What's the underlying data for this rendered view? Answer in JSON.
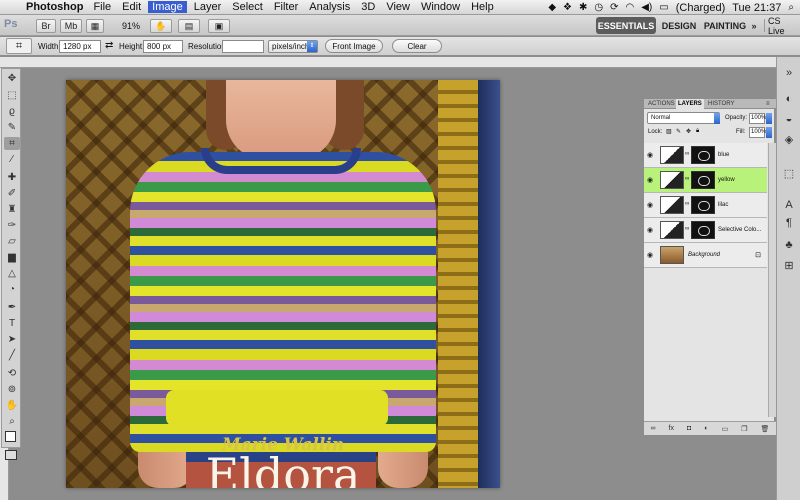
{
  "menubar": {
    "app_name": "Photoshop",
    "items": [
      "File",
      "Edit",
      "Image",
      "Layer",
      "Select",
      "Filter",
      "Analysis",
      "3D",
      "View",
      "Window",
      "Help"
    ],
    "selected_item": "Image",
    "status": {
      "battery": "(Charged)",
      "clock": "Tue 21:37"
    }
  },
  "appbar": {
    "logo": "Ps",
    "zoom": "91%",
    "workspaces": {
      "essentials": "ESSENTIALS",
      "design": "DESIGN",
      "painting": "PAINTING",
      "more": "»"
    },
    "cs_live": "CS Live"
  },
  "options": {
    "width_label": "Width:",
    "width_value": "1280 px",
    "height_label": "Height:",
    "height_value": "800 px",
    "resolution_label": "Resolution:",
    "resolution_value": "",
    "resolution_unit": "pixels/inch",
    "front_image": "Front Image",
    "clear": "Clear"
  },
  "canvas": {
    "title_line1": "Marie Wallin",
    "title_line2": "Eldora"
  },
  "layers_panel": {
    "tabs": [
      "ACTIONS",
      "LAYERS",
      "HISTORY"
    ],
    "active_tab": "LAYERS",
    "blend_mode": "Normal",
    "opacity_label": "Opacity:",
    "opacity": "100%",
    "lock_label": "Lock:",
    "fill_label": "Fill:",
    "fill": "100%",
    "layers": [
      {
        "name": "blue",
        "kind": "adjustment",
        "selected": false
      },
      {
        "name": "yellow",
        "kind": "adjustment",
        "selected": true
      },
      {
        "name": "lilac",
        "kind": "adjustment",
        "selected": false
      },
      {
        "name": "Selective Colo...",
        "kind": "adjustment",
        "selected": false
      },
      {
        "name": "Background",
        "kind": "background",
        "selected": false
      }
    ],
    "selected_color": "#b8f27a"
  },
  "icons": {
    "tools": [
      "move-icon",
      "marquee-icon",
      "lasso-icon",
      "quick-select-icon",
      "crop-icon",
      "eyedropper-icon",
      "healing-icon",
      "brush-icon",
      "clone-stamp-icon",
      "history-brush-icon",
      "eraser-icon",
      "gradient-icon",
      "blur-icon",
      "dodge-icon",
      "pen-icon",
      "type-icon",
      "path-select-icon",
      "shape-icon",
      "3d-rotate-icon",
      "3d-orbit-icon",
      "hand-icon",
      "zoom-icon"
    ]
  }
}
